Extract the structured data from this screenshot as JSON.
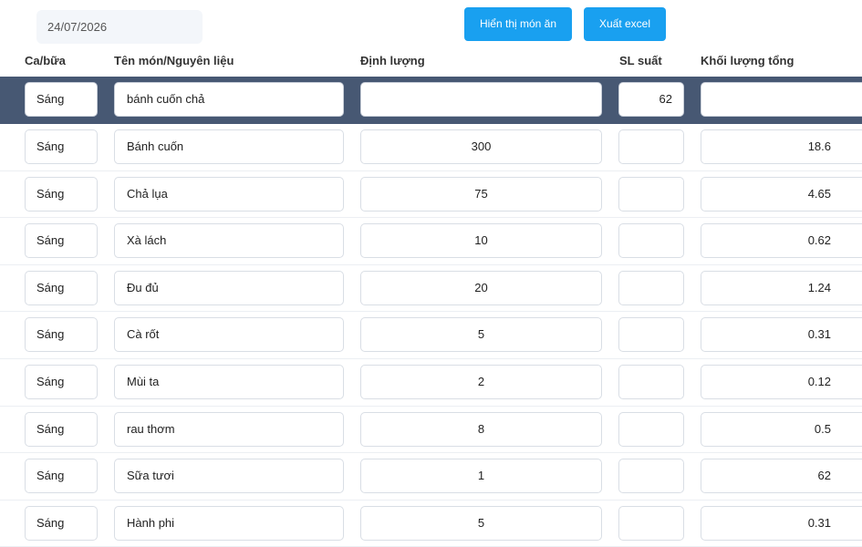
{
  "header": {
    "date_value": "24/07/2026",
    "show_dishes_label": "Hiển thị món ăn",
    "export_excel_label": "Xuất excel"
  },
  "columns": {
    "meal": "Ca/bữa",
    "dish_ingredient": "Tên món/Nguyên liệu",
    "quantity": "Định lượng",
    "servings": "SL suất",
    "total_weight": "Khối lượng tổng"
  },
  "dish_row": {
    "meal": "Sáng",
    "name": "bánh cuốn chả",
    "quantity": "",
    "servings": "62",
    "total": ""
  },
  "rows": [
    {
      "meal": "Sáng",
      "name": "Bánh cuốn",
      "quantity": "300",
      "servings": "",
      "total": "18.6"
    },
    {
      "meal": "Sáng",
      "name": "Chả lụa",
      "quantity": "75",
      "servings": "",
      "total": "4.65"
    },
    {
      "meal": "Sáng",
      "name": "Xà lách",
      "quantity": "10",
      "servings": "",
      "total": "0.62"
    },
    {
      "meal": "Sáng",
      "name": "Đu đủ",
      "quantity": "20",
      "servings": "",
      "total": "1.24"
    },
    {
      "meal": "Sáng",
      "name": "Cà rốt",
      "quantity": "5",
      "servings": "",
      "total": "0.31"
    },
    {
      "meal": "Sáng",
      "name": "Mùi ta",
      "quantity": "2",
      "servings": "",
      "total": "0.12"
    },
    {
      "meal": "Sáng",
      "name": "rau thơm",
      "quantity": "8",
      "servings": "",
      "total": "0.5"
    },
    {
      "meal": "Sáng",
      "name": "Sữa tươi",
      "quantity": "1",
      "servings": "",
      "total": "62"
    },
    {
      "meal": "Sáng",
      "name": "Hành phi",
      "quantity": "5",
      "servings": "",
      "total": "0.31"
    }
  ]
}
